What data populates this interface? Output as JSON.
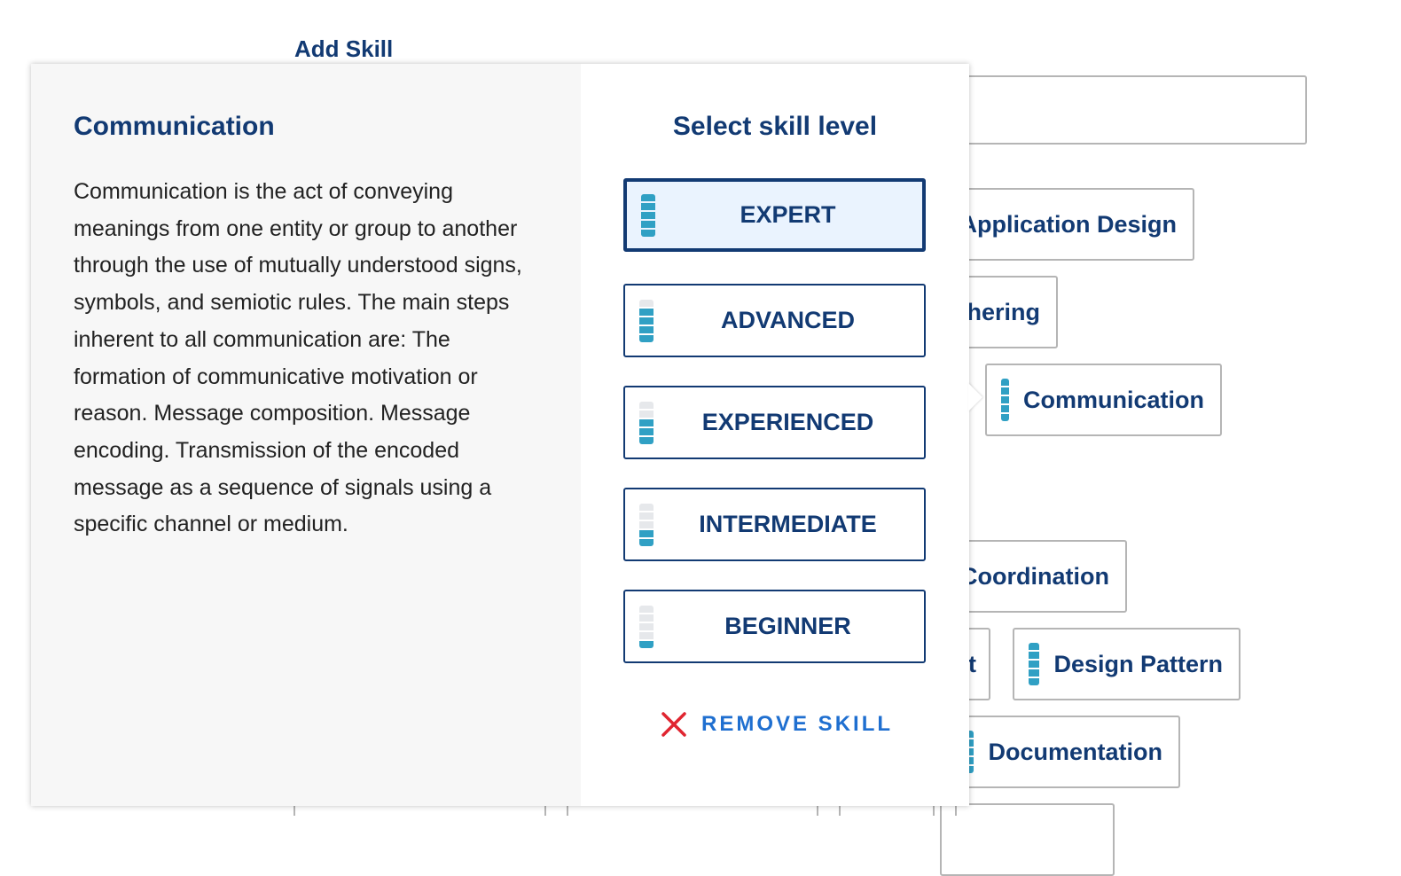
{
  "header": {
    "add_skill": "Add Skill"
  },
  "background_chips": [
    {
      "label": "Application Design",
      "level": null
    },
    {
      "label": "thering",
      "level": null
    },
    {
      "label": "Communication",
      "level": 5
    },
    {
      "label": "Coordination",
      "level": null
    },
    {
      "label": "t",
      "level": null
    },
    {
      "label": "Design Pattern",
      "level": 5
    },
    {
      "label": "Documentation",
      "level": 5
    }
  ],
  "popup": {
    "skill_name": "Communication",
    "description": "Communication is the act of conveying meanings from one entity or group to another through the use of mutually understood signs, symbols, and semiotic rules. The main steps inherent to all communication are: The formation of communicative motivation or reason. Message composition. Message encoding. Transmission of the encoded message as a sequence of signals using a specific channel or medium.",
    "select_title": "Select skill level",
    "levels": [
      {
        "label": "EXPERT",
        "filled": 5,
        "selected": true
      },
      {
        "label": "ADVANCED",
        "filled": 4,
        "selected": false
      },
      {
        "label": "EXPERIENCED",
        "filled": 3,
        "selected": false
      },
      {
        "label": "INTERMEDIATE",
        "filled": 2,
        "selected": false
      },
      {
        "label": "BEGINNER",
        "filled": 1,
        "selected": false
      }
    ],
    "remove_label": "REMOVE SKILL"
  },
  "colors": {
    "navy": "#123a73",
    "teal": "#30a0c4",
    "selected_bg": "#eaf3fe",
    "remove_icon": "#e02530",
    "remove_text": "#1f6fd0"
  }
}
